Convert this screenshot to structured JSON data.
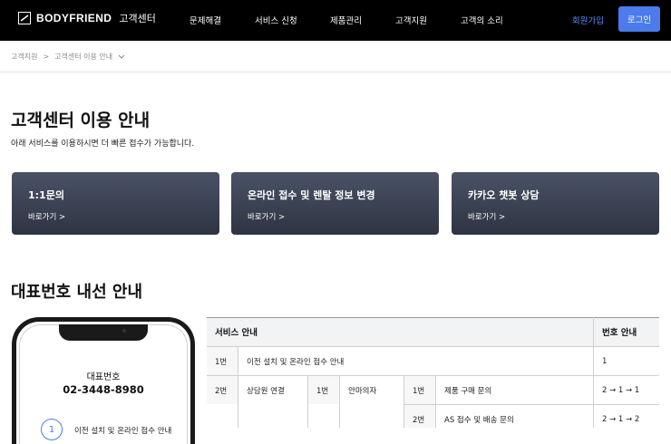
{
  "header": {
    "brand": "BODYFRIEND",
    "brand_sub": "고객센터",
    "nav": [
      "문제해결",
      "서비스 신청",
      "제품관리",
      "고객지원",
      "고객의 소리"
    ],
    "signup": "회원가입",
    "login": "로그인"
  },
  "breadcrumb": {
    "root": "고객지원",
    "sep": ">",
    "current": "고객센터 이용 안내"
  },
  "page": {
    "title": "고객센터 이용 안내",
    "description": "아래 서비스를 이용하시면 더 빠른 접수가 가능합니다."
  },
  "cards": [
    {
      "title": "1:1문의",
      "link": "바로가기 >"
    },
    {
      "title": "온라인 접수 및 렌탈 정보 변경",
      "link": "바로가기 >"
    },
    {
      "title": "카카오 챗봇 상담",
      "link": "바로가기 >"
    }
  ],
  "section2": {
    "title": "대표번호 내선 안내"
  },
  "phone": {
    "label": "대표번호",
    "number": "02-3448-8980",
    "step_num": "1",
    "step_text": "이전 설치 및 온라인 접수 안내"
  },
  "table": {
    "headers": {
      "service": "서비스 안내",
      "number": "번호 안내"
    },
    "row1": {
      "no": "1번",
      "desc": "이전 설치 및 온라인 접수 안내",
      "num": "1"
    },
    "row2": {
      "no": "2번",
      "desc": "상담원 연결",
      "sub_no": "1번",
      "sub_desc": "안마의자",
      "items": [
        {
          "no": "1번",
          "desc": "제품 구매 문의",
          "num": "2 → 1 → 1"
        },
        {
          "no": "2번",
          "desc": "AS 접수 및 배송 문의",
          "num": "2 → 1 → 2"
        }
      ]
    }
  },
  "colors": {
    "accent": "#4b7bec",
    "header_bg": "#000000",
    "card_top": "#4a5266",
    "card_bottom": "#2e3442"
  }
}
